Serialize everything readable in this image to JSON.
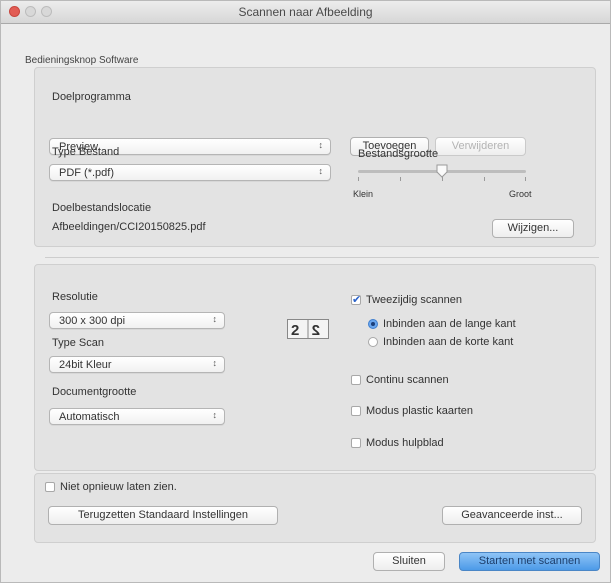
{
  "window": {
    "title": "Scannen naar Afbeelding"
  },
  "group": {
    "title": "Bedieningsknop Software"
  },
  "target_app": {
    "label": "Doelprogramma",
    "value": "Preview",
    "add_button": "Toevoegen",
    "remove_button": "Verwijderen"
  },
  "file_type": {
    "label": "Type Bestand",
    "value": "PDF (*.pdf)"
  },
  "file_size": {
    "label": "Bestandsgrootte",
    "min_label": "Klein",
    "max_label": "Groot",
    "level": 0.5
  },
  "destination": {
    "label": "Doelbestandslocatie",
    "value": "Afbeeldingen/CCI20150825.pdf",
    "change_button": "Wijzigen..."
  },
  "resolution": {
    "label": "Resolutie",
    "value": "300 x 300 dpi"
  },
  "scan_type": {
    "label": "Type Scan",
    "value": "24bit Kleur"
  },
  "document_size": {
    "label": "Documentgrootte",
    "value": "Automatisch"
  },
  "duplex": {
    "checkbox_label": "Tweezijdig scannen",
    "checked": true,
    "options": [
      "Inbinden aan de lange kant",
      "Inbinden aan de korte kant"
    ],
    "selected_index": 0,
    "icon": "duplex-binding-icon"
  },
  "continuous_scan": {
    "label": "Continu scannen",
    "checked": false
  },
  "plastic_card_mode": {
    "label": "Modus plastic kaarten",
    "checked": false
  },
  "carrier_sheet_mode": {
    "label": "Modus hulpblad",
    "checked": false
  },
  "dont_show_again": {
    "label": "Niet opnieuw laten zien.",
    "checked": false
  },
  "reset_button": "Terugzetten Standaard Instellingen",
  "advanced_button": "Geavanceerde inst...",
  "close_button": "Sluiten",
  "start_button": "Starten met scannen"
}
